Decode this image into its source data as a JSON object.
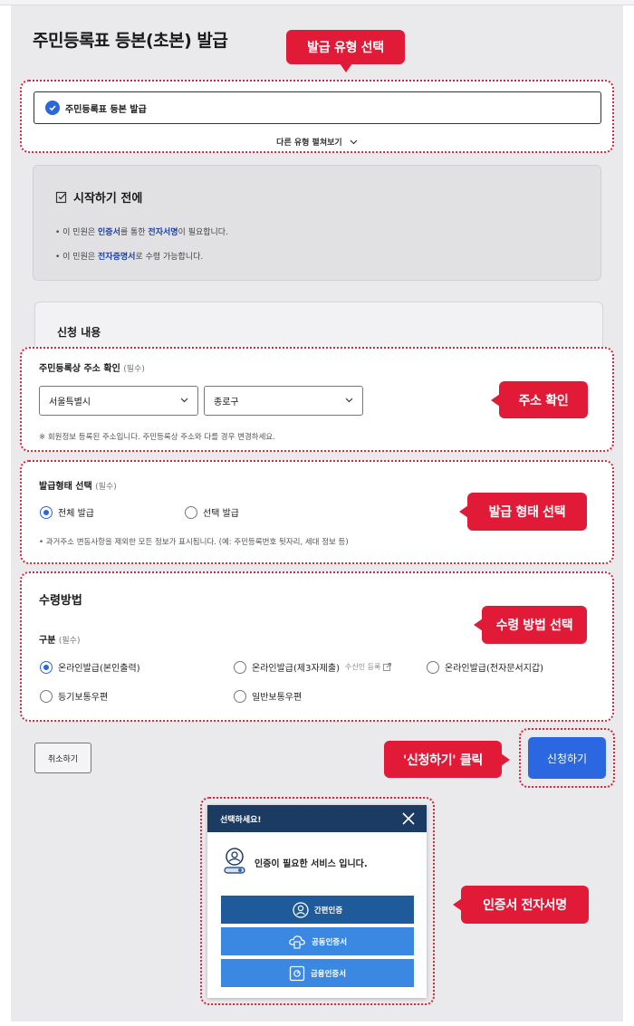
{
  "page": {
    "title": "주민등록표 등본(초본) 발급"
  },
  "callouts": {
    "type_select": "발급 유형 선택",
    "address": "주소 확인",
    "issue_form": "발급 형태 선택",
    "receive_method": "수령 방법 선택",
    "click_apply": "'신청하기' 클릭",
    "cert_sign": "인증서 전자서명"
  },
  "issue_type": {
    "selected": "주민등록표 등본 발급",
    "more_link": "다른 유형 펼쳐보기"
  },
  "before_start": {
    "title": "시작하기 전에",
    "line1": {
      "prefix": "• 이 민원은 ",
      "bold1": "인증서",
      "mid": "를 통한 ",
      "bold2": "전자서명",
      "suffix": "이 필요합니다."
    },
    "line2": {
      "prefix": "• 이 민원은 ",
      "bold1": "전자증명서",
      "suffix": "로 수령 가능합니다."
    }
  },
  "apply_content": {
    "title": "신청 내용"
  },
  "address": {
    "label": "주민등록상 주소 확인",
    "required": "(필수)",
    "city": "서울특별시",
    "district": "종로구",
    "note": "※ 회원정보 등록된 주소입니다. 주민등록상 주소와 다를 경우 변경하세요."
  },
  "issue_form": {
    "label": "발급형태 선택",
    "required": "(필수)",
    "options": [
      "전체 발급",
      "선택 발급"
    ],
    "selected_index": 0,
    "note": "• 과거주소 변동사항을 제외한 모든 정보가 표시됩니다. (예: 주민등록번호 뒷자리, 세대 정보 등)"
  },
  "receive": {
    "title": "수령방법",
    "sub_label": "구분",
    "required": "(필수)",
    "options": [
      "온라인발급(본인출력)",
      "온라인발급(제3자제출)",
      "온라인발급(전자문서지갑)",
      "등기보통우편",
      "일반보통우편"
    ],
    "recipient_link": "수신인 등록",
    "selected_index": 0
  },
  "buttons": {
    "cancel": "취소하기",
    "apply": "신청하기"
  },
  "modal": {
    "title": "선택하세요!",
    "message": "인증이 필요한 서비스 입니다.",
    "options": [
      "간편인증",
      "공동인증서",
      "금융인증서"
    ]
  },
  "colors": {
    "accent_red": "#e11b37",
    "primary_blue": "#2b67e0",
    "modal_header": "#1b3b63"
  }
}
